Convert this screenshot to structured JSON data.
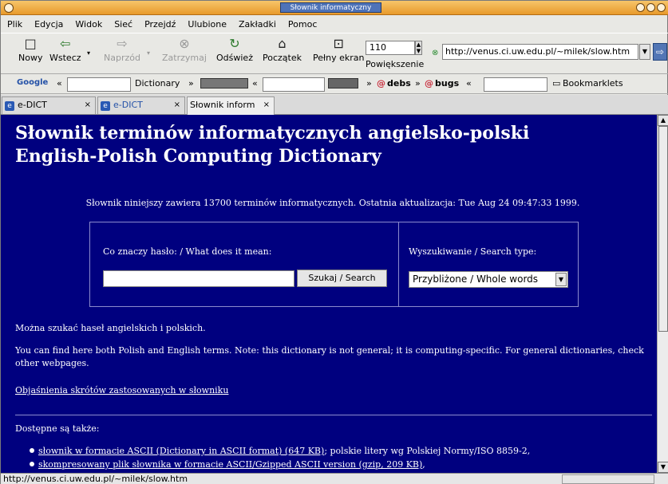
{
  "window": {
    "title": "Słownik informatyczny"
  },
  "menu": [
    "Plik",
    "Edycja",
    "Widok",
    "Sieć",
    "Przejdź",
    "Ulubione",
    "Zakładki",
    "Pomoc"
  ],
  "toolbar": {
    "new": "Nowy",
    "back": "Wstecz",
    "forward": "Naprzód",
    "stop": "Zatrzymaj",
    "reload": "Odśwież",
    "home": "Początek",
    "fullscreen": "Pełny ekran",
    "zoom_label": "Powiększenie",
    "zoom_value": "110",
    "url": "http://venus.ci.uw.edu.pl/~milek/slow.htm"
  },
  "bookmarks": {
    "google": "Google",
    "dictionary": "Dictionary",
    "debs": "debs",
    "bugs": "bugs",
    "bookmarklets": "Bookmarklets"
  },
  "tabs": [
    {
      "label": "e-DICT"
    },
    {
      "label": "e-DICT"
    },
    {
      "label": "Słownik inform"
    }
  ],
  "page": {
    "title_pl": "Słownik terminów informatycznych angielsko-polski",
    "title_en": "English-Polish Computing Dictionary",
    "info": "Słownik niniejszy zawiera 13700 terminów informatycznych. Ostatnia aktualizacja: Tue Aug 24 09:47:33 1999.",
    "query_label": "Co znaczy hasło: / What does it mean:",
    "search_button": "Szukaj / Search",
    "search_type_label": "Wyszukiwanie / Search type:",
    "search_type_value": "Przybliżone / Whole words",
    "note_pl": "Można szukać haseł angielskich i polskich.",
    "note_en": "You can find here both Polish and English terms. Note: this dictionary is not general; it is computing-specific. For general dictionaries, check other webpages.",
    "abbrev_link": "Objaśnienia skrótów zastosowanych w słowniku",
    "available": "Dostępne są także:",
    "items": [
      {
        "link": "słownik w formacie ASCII (Dictionary in ASCII format) (647 KB)",
        "rest": "; polskie litery wg Polskiej Normy/ISO 8859-2,"
      },
      {
        "link": "skompresowany plik słownika w formacie ASCII/Gzipped ASCII version (gzip, 209 KB)",
        "rest": ","
      }
    ]
  },
  "status": "http://venus.ci.uw.edu.pl/~milek/slow.htm"
}
